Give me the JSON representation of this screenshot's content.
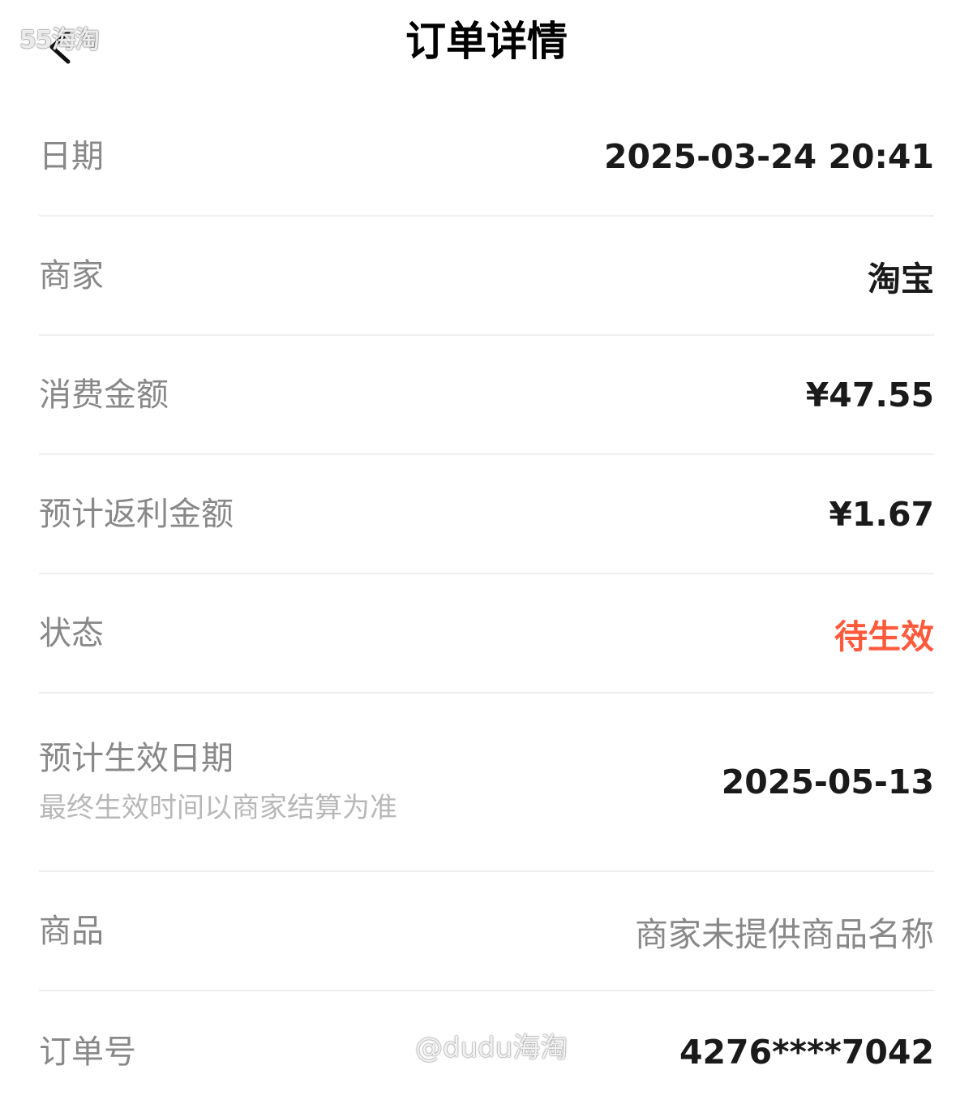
{
  "header": {
    "title": "订单详情",
    "back_icon": "chevron-left-icon"
  },
  "watermarks": {
    "top_left": "55海淘",
    "bottom": "@dudu海淘"
  },
  "order": {
    "date": {
      "label": "日期",
      "value": "2025-03-24 20:41"
    },
    "merchant": {
      "label": "商家",
      "value": "淘宝"
    },
    "amount": {
      "label": "消费金额",
      "value": "¥47.55"
    },
    "rebate": {
      "label": "预计返利金额",
      "value": "¥1.67"
    },
    "status": {
      "label": "状态",
      "value": "待生效"
    },
    "effective_date": {
      "label": "预计生效日期",
      "sublabel": "最终生效时间以商家结算为准",
      "value": "2025-05-13"
    },
    "product": {
      "label": "商品",
      "value": "商家未提供商品名称"
    },
    "order_no": {
      "label": "订单号",
      "value": "4276****7042"
    }
  },
  "colors": {
    "status": "#ff5a3c",
    "label": "#888888",
    "value": "#1a1a1a",
    "divider": "#efefef"
  }
}
